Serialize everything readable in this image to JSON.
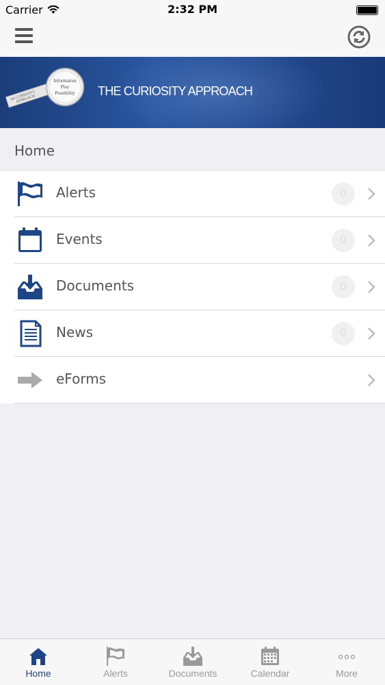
{
  "status_bar": {
    "carrier": "Carrier",
    "time": "2:32 PM"
  },
  "navbar": {
    "menu_icon": "hamburger-icon",
    "refresh_icon": "refresh-icon"
  },
  "banner": {
    "title": "THE CURIOSITY APPROACH",
    "logo_text": [
      "Information",
      "Play",
      "Possibility",
      "the CURIOSITY APPROACH"
    ]
  },
  "breadcrumb": {
    "label": "Home"
  },
  "menu": {
    "items": [
      {
        "label": "Alerts",
        "icon": "flag-icon",
        "badge": "0"
      },
      {
        "label": "Events",
        "icon": "calendar-icon",
        "badge": "0"
      },
      {
        "label": "Documents",
        "icon": "inbox-download-icon",
        "badge": "0"
      },
      {
        "label": "News",
        "icon": "document-icon",
        "badge": "0"
      },
      {
        "label": "eForms",
        "icon": "arrow-right-icon"
      }
    ]
  },
  "tabbar": {
    "tabs": [
      {
        "label": "Home",
        "icon": "home-icon",
        "active": true
      },
      {
        "label": "Alerts",
        "icon": "flag-icon"
      },
      {
        "label": "Documents",
        "icon": "inbox-download-icon"
      },
      {
        "label": "Calendar",
        "icon": "calendar-icon"
      },
      {
        "label": "More",
        "icon": "more-dots-icon"
      }
    ]
  },
  "colors": {
    "brand": "#1e4686",
    "accent_banner": "#24498e",
    "inactive": "#999999"
  }
}
